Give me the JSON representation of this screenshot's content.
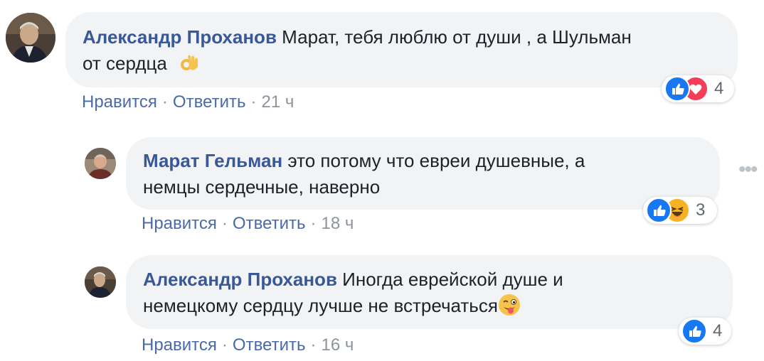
{
  "comments": [
    {
      "author": "Александр Проханов",
      "text_line1": "Марат, тебя люблю от души , а Шульман",
      "text_line2": "от сердца",
      "emoji": "ok-hand-icon",
      "actions": {
        "like": "Нравится",
        "reply": "Ответить",
        "time": "21 ч"
      },
      "reaction_count": "4",
      "reactions": [
        "like-icon",
        "love-icon"
      ]
    },
    {
      "author": "Марат Гельман",
      "text_line1": "это потому что евреи душевные, а",
      "text_line2": "немцы сердечные, наверно",
      "actions": {
        "like": "Нравится",
        "reply": "Ответить",
        "time": "18 ч"
      },
      "reaction_count": "3",
      "reactions": [
        "like-icon",
        "haha-icon"
      ]
    },
    {
      "author": "Александр Проханов",
      "text_line1": "Иногда еврейской душе и",
      "text_line2": "немецкому сердцу лучше не встречаться",
      "emoji": "winking-tongue-face-icon",
      "actions": {
        "like": "Нравится",
        "reply": "Ответить",
        "time": "16 ч"
      },
      "reaction_count": "4",
      "reactions": [
        "like-icon"
      ]
    }
  ],
  "separator": "·",
  "colors": {
    "author": "#385898",
    "link": "#4b6aa8",
    "meta": "#8d949e",
    "bubble": "#f2f3f5",
    "like": "#1877f2",
    "love": "#f33e58",
    "haha": "#f7b125"
  }
}
